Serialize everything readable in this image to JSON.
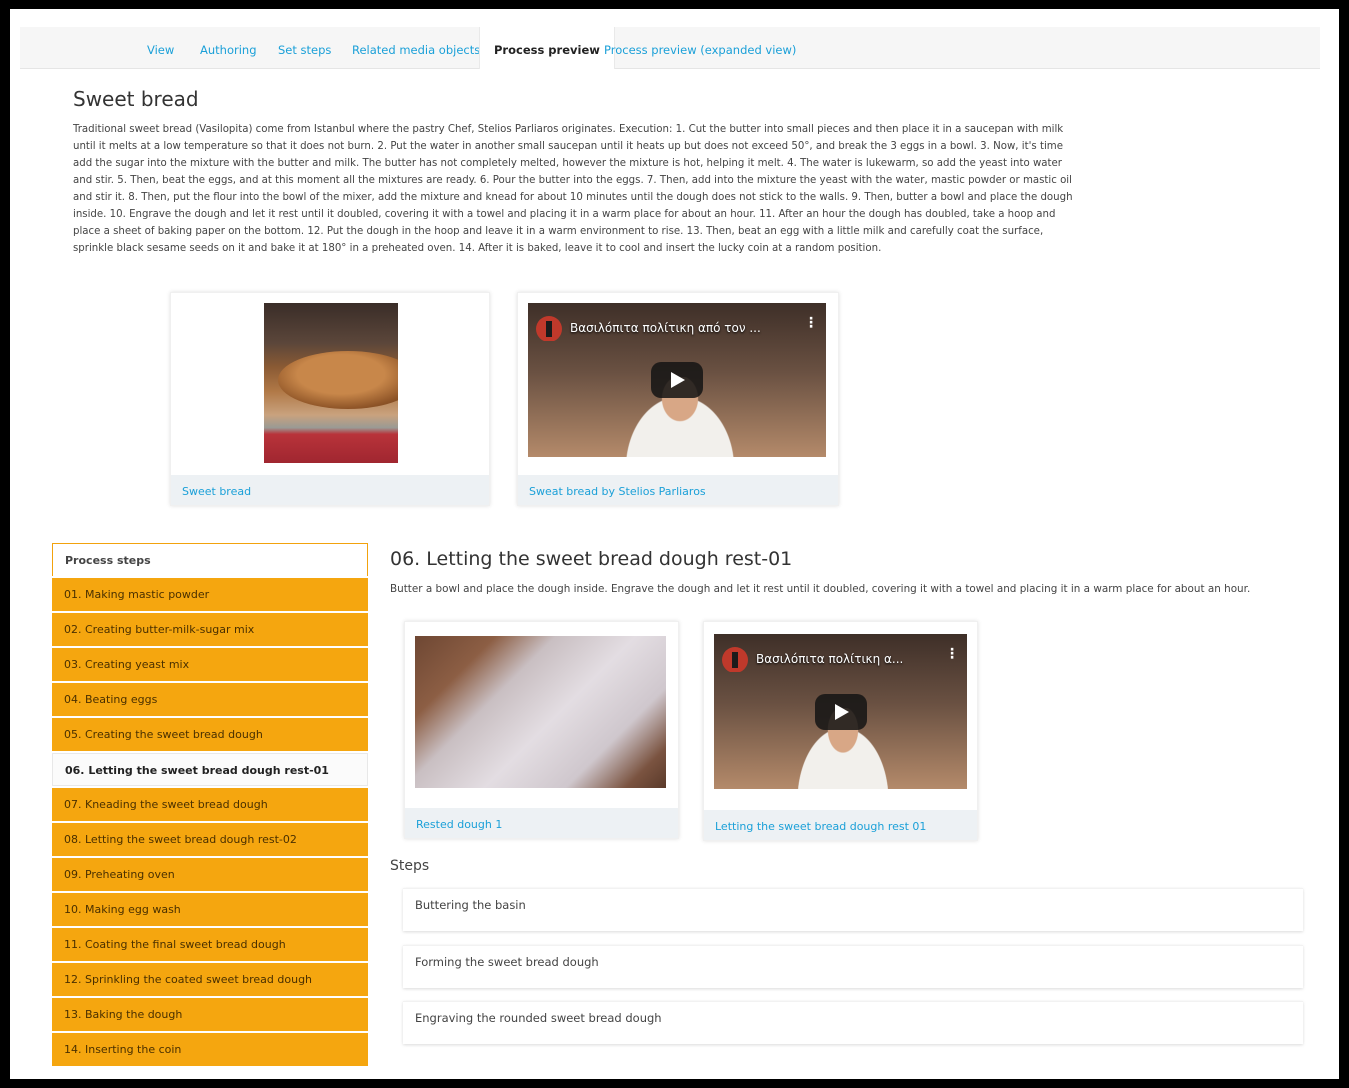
{
  "tabs": [
    {
      "label": "View"
    },
    {
      "label": "Authoring"
    },
    {
      "label": "Set steps"
    },
    {
      "label": "Related media objects"
    },
    {
      "label": "Process preview"
    },
    {
      "label": "Process preview (expanded view)"
    }
  ],
  "active_tab": "Process preview",
  "process": {
    "title": "Sweet bread",
    "description": "Traditional sweet bread (Vasilopita) come from Istanbul where the pastry Chef, Stelios Parliaros originates. Execution: 1. Cut the butter into small pieces and then place it in a saucepan with milk until it melts at a low temperature so that it does not burn. 2. Put the water in another small saucepan until it heats up but does not exceed 50°, and break the 3 eggs in a bowl. 3. Now, it's time add the sugar into the mixture with the butter and milk. The butter has not completely melted, however the mixture is hot, helping it melt. 4. The water is lukewarm, so add the yeast into water and stir. 5. Then, beat the eggs, and at this moment all the mixtures are ready. 6. Pour the butter into the eggs. 7. Then, add into the mixture the yeast with the water, mastic powder or mastic oil and stir it. 8. Then, put the flour into the bowl of the mixer, add the mixture and knead for about 10 minutes until the dough does not stick to the walls. 9. Then, butter a bowl and place the dough inside. 10. Engrave the dough and let it rest until it doubled, covering it with a towel and placing it in a warm place for about an hour. 11. After an hour the dough has doubled, take a hoop and place a sheet of baking paper on the bottom. 12. Put the dough in the hoop and leave it in a warm environment to rise. 13. Then, beat an egg with a little milk and carefully coat the surface, sprinkle black sesame seeds on it and bake it at 180° in a preheated oven. 14. After it is baked, leave it to cool and insert the lucky coin at a random position.",
    "media": [
      {
        "caption": "Sweet bread",
        "kind": "image"
      },
      {
        "caption": "Sweat bread by Stelios Parliaros",
        "kind": "video",
        "video_title": "Βασιλόπιτα πολίτικη από τον ..."
      }
    ]
  },
  "sidebar": {
    "header": "Process steps",
    "items": [
      {
        "label": "01. Making mastic powder"
      },
      {
        "label": "02. Creating butter-milk-sugar mix"
      },
      {
        "label": "03. Creating yeast mix"
      },
      {
        "label": "04. Beating eggs"
      },
      {
        "label": "05. Creating the sweet bread dough"
      },
      {
        "label": "06. Letting the sweet bread dough rest-01"
      },
      {
        "label": "07. Kneading the sweet bread dough"
      },
      {
        "label": "08. Letting the sweet bread dough rest-02"
      },
      {
        "label": "09. Preheating oven"
      },
      {
        "label": "10. Making egg wash"
      },
      {
        "label": "11. Coating the final sweet bread dough"
      },
      {
        "label": "12. Sprinkling the coated sweet bread dough"
      },
      {
        "label": "13. Baking the dough"
      },
      {
        "label": "14. Inserting the coin"
      }
    ],
    "active_item": "06. Letting the sweet bread dough rest-01"
  },
  "step_detail": {
    "title": "06. Letting the sweet bread dough rest-01",
    "description": "Butter a bowl and place the dough inside. Engrave the dough and let it rest until it doubled, covering it with a towel and placing it in a warm place for about an hour.",
    "media": [
      {
        "caption": "Rested dough 1",
        "kind": "image"
      },
      {
        "caption": "Letting the sweet bread dough rest 01",
        "kind": "video",
        "video_title": "Βασιλόπιτα πολίτικη α..."
      }
    ],
    "steps_label": "Steps",
    "substeps": [
      {
        "label": "Buttering the basin"
      },
      {
        "label": "Forming the sweet bread dough"
      },
      {
        "label": "Engraving the rounded sweet bread dough"
      }
    ]
  },
  "colors": {
    "accent_link": "#1ba0d8",
    "step_orange": "#f5a60f",
    "caption_bg": "#edf1f4"
  },
  "icons": [
    "play-icon",
    "kebab-menu-icon",
    "channel-logo-icon"
  ]
}
